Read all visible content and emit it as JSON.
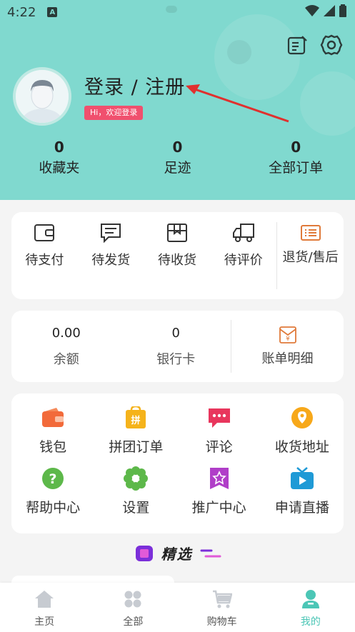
{
  "status_bar": {
    "time": "4:22",
    "a_badge": "A"
  },
  "profile": {
    "login_text": "登录 / 注册",
    "hi_badge": "Hi，欢迎登录"
  },
  "stats": [
    {
      "value": "0",
      "label": "收藏夹"
    },
    {
      "value": "0",
      "label": "足迹"
    },
    {
      "value": "0",
      "label": "全部订单"
    }
  ],
  "orders": [
    {
      "label": "待支付",
      "icon": "wallet-outline-icon"
    },
    {
      "label": "待发货",
      "icon": "message-box-icon"
    },
    {
      "label": "待收货",
      "icon": "package-icon"
    },
    {
      "label": "待评价",
      "icon": "truck-icon"
    },
    {
      "label": "退货/售后",
      "icon": "return-list-icon"
    }
  ],
  "wallet": {
    "balance_value": "0.00",
    "balance_label": "余额",
    "cards_value": "0",
    "cards_label": "银行卡",
    "bill_label": "账单明细"
  },
  "services": [
    {
      "label": "钱包",
      "icon": "wallet-icon",
      "color": "#f26a3a"
    },
    {
      "label": "拼团订单",
      "icon": "group-order-icon",
      "color": "#f5b31b"
    },
    {
      "label": "评论",
      "icon": "comment-icon",
      "color": "#e8365d"
    },
    {
      "label": "收货地址",
      "icon": "location-icon",
      "color": "#f7a81a"
    },
    {
      "label": "帮助中心",
      "icon": "help-icon",
      "color": "#5db84a"
    },
    {
      "label": "设置",
      "icon": "settings-flower-icon",
      "color": "#5db84a"
    },
    {
      "label": "推广中心",
      "icon": "promote-star-icon",
      "color": "#b03ec8"
    },
    {
      "label": "申请直播",
      "icon": "live-tv-icon",
      "color": "#1f9ad6"
    }
  ],
  "featured": {
    "title": "精选"
  },
  "tabbar": [
    {
      "label": "主页",
      "icon": "home-icon",
      "active": false
    },
    {
      "label": "全部",
      "icon": "grid-icon",
      "active": false
    },
    {
      "label": "购物车",
      "icon": "cart-icon",
      "active": false
    },
    {
      "label": "我的",
      "icon": "profile-icon",
      "active": true
    }
  ],
  "colors": {
    "header_bg": "#80d9cf",
    "accent": "#4cc6b6",
    "badge": "#f0506e",
    "arrow": "#e0302e"
  }
}
